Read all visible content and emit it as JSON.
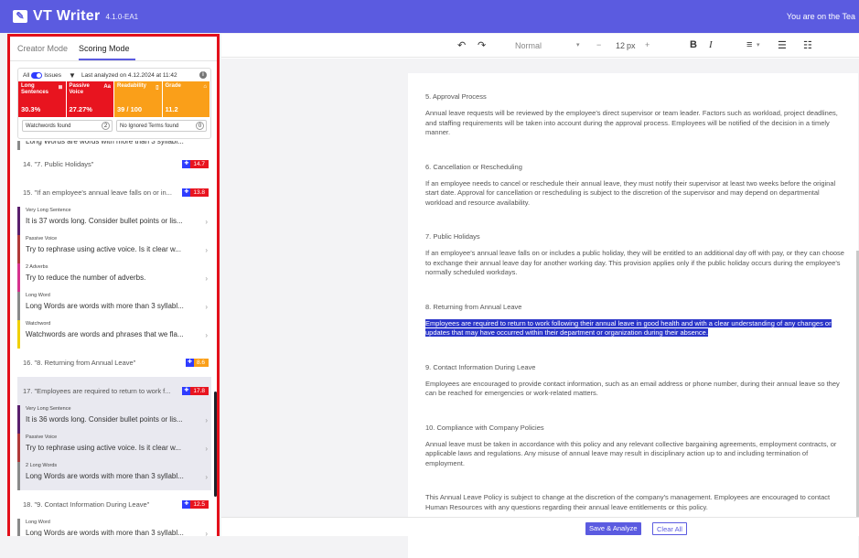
{
  "app": {
    "title": "VT Writer",
    "version": "4.1.0-EA1",
    "user_note": "You are on the Tea"
  },
  "sidebar": {
    "tabs": [
      {
        "label": "Creator Mode"
      },
      {
        "label": "Scoring Mode"
      }
    ],
    "issues_label": "All",
    "issues_toggle_label": "Issues",
    "last_analyzed": "Last analyzed on 4.12.2024 at 11:42",
    "metrics": [
      {
        "label": "Long Sentences",
        "value": "30.3%",
        "color": "#e8141f"
      },
      {
        "label": "Passive Voice",
        "value": "27.27%",
        "color": "#e8141f"
      },
      {
        "label": "Readability",
        "value": "39 / 100",
        "color": "#fa9f19"
      },
      {
        "label": "Grade",
        "value": "11.2",
        "color": "#fa9f19"
      }
    ],
    "watchwords": {
      "label": "Watchwords found",
      "count": "2"
    },
    "ignored": {
      "label": "No Ignored Terms found",
      "count": "0"
    },
    "items": [
      {
        "type": "issue_partial",
        "desc": "Long Words are words with more than 3 syllabl..."
      },
      {
        "type": "sentence",
        "label": "14. \"7. Public Holidays\"",
        "score": "14.7",
        "badge": "red"
      },
      {
        "type": "sentence",
        "label": "15. \"If an employee's annual leave falls on or in...",
        "score": "13.8",
        "badge": "red"
      },
      {
        "type": "issue",
        "itype": "Very Long Sentence",
        "desc": "It is 37 words long. Consider bullet points or lis...",
        "color": "#5a1f6d"
      },
      {
        "type": "issue",
        "itype": "Passive Voice",
        "desc": "Try to rephrase using active voice. Is it clear w...",
        "color": "#b03a3a"
      },
      {
        "type": "issue",
        "itype": "2 Adverbs",
        "desc": "Try to reduce the number of adverbs.",
        "color": "#d6338e"
      },
      {
        "type": "issue",
        "itype": "Long Word",
        "desc": "Long Words are words with more than 3 syllabl...",
        "color": "#8a8a8a"
      },
      {
        "type": "issue",
        "itype": "Watchword",
        "desc": "Watchwords are words and phrases that we fla...",
        "color": "#f0d000"
      },
      {
        "type": "sentence",
        "label": "16. \"8. Returning from Annual Leave\"",
        "score": "8.6",
        "badge": "orange"
      },
      {
        "type": "sentence",
        "label": "17. \"Employees are required to return to work f...",
        "score": "17.8",
        "badge": "red",
        "selected": true
      },
      {
        "type": "issue",
        "itype": "Very Long Sentence",
        "desc": "It is 36 words long. Consider bullet points or lis...",
        "color": "#5a1f6d",
        "selected": true
      },
      {
        "type": "issue",
        "itype": "Passive Voice",
        "desc": "Try to rephrase using active voice. Is it clear w...",
        "color": "#b03a3a",
        "selected": true
      },
      {
        "type": "issue",
        "itype": "2 Long Words",
        "desc": "Long Words are words with more than 3 syllabl...",
        "color": "#8a8a8a",
        "selected": true
      },
      {
        "type": "sentence",
        "label": "18. \"9. Contact Information During Leave\"",
        "score": "12.5",
        "badge": "red"
      },
      {
        "type": "issue",
        "itype": "Long Word",
        "desc": "Long Words are words with more than 3 syllabl...",
        "color": "#8a8a8a"
      }
    ]
  },
  "toolbar": {
    "style": "Normal",
    "font_size": "12",
    "font_unit": "px",
    "bold": "B",
    "italic": "I"
  },
  "document": {
    "sections": [
      {
        "heading": "5. Approval Process",
        "body": "Annual leave requests will be reviewed by the employee's direct supervisor or team leader. Factors such as workload, project deadlines, and staffing requirements will be taken into account during the approval process. Employees will be notified of the decision in a timely manner."
      },
      {
        "heading": "6. Cancellation or Rescheduling",
        "body": "If an employee needs to cancel or reschedule their annual leave, they must notify their supervisor at least two weeks before the original start date. Approval for cancellation or rescheduling is subject to the discretion of the supervisor and may depend on departmental workload and resource availability."
      },
      {
        "heading": "7. Public Holidays",
        "body": "If an employee's annual leave falls on or includes a public holiday, they will be entitled to an additional day off with pay, or they can choose to exchange their annual leave day for another working day. This provision applies only if the public holiday occurs during the employee's normally scheduled workdays."
      },
      {
        "heading": "8. Returning from Annual Leave",
        "body": "Employees are required to return to work following their annual leave in good health and with a clear understanding of any changes or updates that may have occurred within their department or organization during their absence.",
        "highlight": true
      },
      {
        "heading": "9. Contact Information During Leave",
        "body": "Employees are encouraged to provide contact information, such as an email address or phone number, during their annual leave so they can be reached for emergencies or work-related matters."
      },
      {
        "heading": "10. Compliance with Company Policies",
        "body": "Annual leave must be taken in accordance with this policy and any relevant collective bargaining agreements, employment contracts, or applicable laws and regulations. Any misuse of annual leave may result in disciplinary action up to and including termination of employment."
      },
      {
        "heading": "",
        "body": "This Annual Leave Policy is subject to change at the discretion of the company's management. Employees are encouraged to contact Human Resources with any questions regarding their annual leave entitlements or this policy."
      }
    ]
  },
  "actions": {
    "save": "Save & Analyze",
    "clear": "Clear All"
  }
}
